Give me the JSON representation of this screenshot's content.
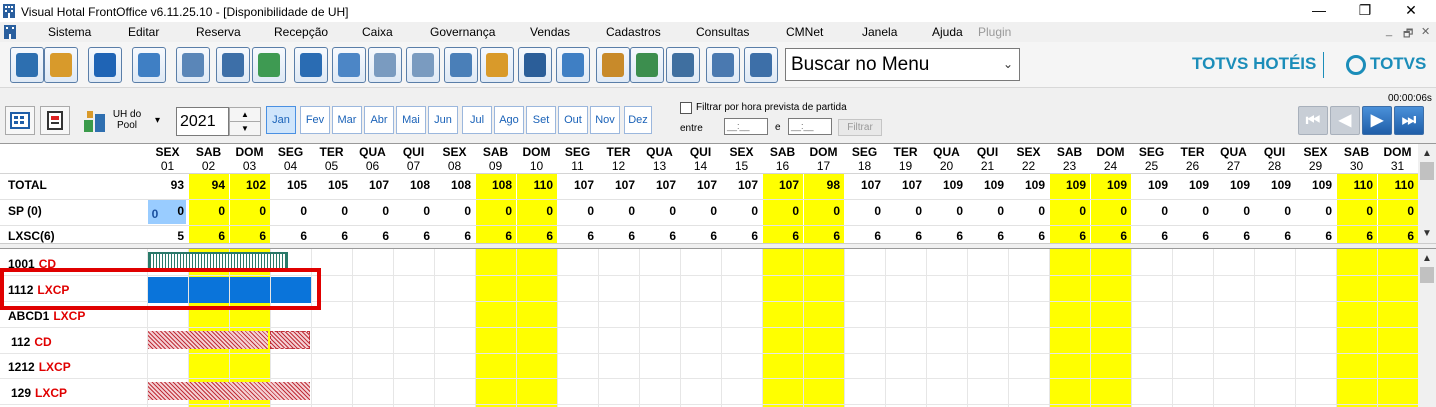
{
  "window": {
    "title": "Visual Hotal FrontOffice v6.11.25.10 - [Disponibilidade de UH]",
    "minimize": "—",
    "restore": "❐",
    "close": "✕"
  },
  "menu": {
    "items": [
      {
        "label": "Sistema"
      },
      {
        "label": "Editar"
      },
      {
        "label": "Reserva"
      },
      {
        "label": "Recepção"
      },
      {
        "label": "Caixa"
      },
      {
        "label": "Governança"
      },
      {
        "label": "Vendas"
      },
      {
        "label": "Cadastros"
      },
      {
        "label": "Consultas"
      },
      {
        "label": "CMNet"
      },
      {
        "label": "Janela"
      },
      {
        "label": "Ajuda"
      },
      {
        "label": "Plugin"
      }
    ],
    "mdi_min": "_",
    "mdi_restore": "🗗",
    "mdi_close": "✕"
  },
  "toolbar": {
    "search_value": "Buscar no Menu",
    "brand_hotels": "TOTVS HOTÉIS",
    "brand_totvs": "TOTVS",
    "buttons": [
      {
        "icon": "exit-icon",
        "color": "#2d6fb0"
      },
      {
        "icon": "user-key-icon",
        "color": "#d89a2b"
      },
      {
        "icon": "help-icon",
        "color": "#1f64b5"
      },
      {
        "icon": "org-chart-icon",
        "color": "#3f7fc4"
      },
      {
        "icon": "mail-icon",
        "color": "#5a86b8"
      },
      {
        "icon": "document-edit-icon",
        "color": "#3d6fa8"
      },
      {
        "icon": "mail-send-icon",
        "color": "#3e9a52"
      },
      {
        "icon": "search-icon",
        "color": "#2a6cb3"
      },
      {
        "icon": "calendar-icon",
        "color": "#4c86c6"
      },
      {
        "icon": "card-icon",
        "color": "#7a9bc0"
      },
      {
        "icon": "id-card-icon",
        "color": "#7a9bc0"
      },
      {
        "icon": "guest-list-icon",
        "color": "#4a7fb8"
      },
      {
        "icon": "bell-icon",
        "color": "#d99a2a"
      },
      {
        "icon": "footprints-icon",
        "color": "#2b5e99"
      },
      {
        "icon": "add-user-icon",
        "color": "#3f7fc4"
      },
      {
        "icon": "service-bell-icon",
        "color": "#c88a2a"
      },
      {
        "icon": "billing-icon",
        "color": "#3c8e4e"
      },
      {
        "icon": "cash-register-icon",
        "color": "#3f6fa0"
      },
      {
        "icon": "housekeeper-icon",
        "color": "#4a79b0"
      },
      {
        "icon": "contacts-icon",
        "color": "#3d6fa8"
      }
    ]
  },
  "controls": {
    "uh_pool_label": "UH do Pool",
    "year": "2021",
    "months": [
      "Jan",
      "Fev",
      "Mar",
      "Abr",
      "Mai",
      "Jun",
      "Jul",
      "Ago",
      "Set",
      "Out",
      "Nov",
      "Dez"
    ],
    "selected_month": "Jan",
    "filter_label": "Filtrar por hora prevista de partida",
    "entre_label": "entre",
    "e_label": "e",
    "time_from": "__:__",
    "time_to": "__:__",
    "filter_button": "Filtrar",
    "timer": "00:00:06s",
    "nav_first": "⏮",
    "nav_prev": "◀",
    "nav_next": "▶",
    "nav_last": "⏭"
  },
  "calendar": {
    "days": [
      {
        "dow": "SEX",
        "day": "01",
        "weekend": false
      },
      {
        "dow": "SAB",
        "day": "02",
        "weekend": true
      },
      {
        "dow": "DOM",
        "day": "03",
        "weekend": true
      },
      {
        "dow": "SEG",
        "day": "04",
        "weekend": false
      },
      {
        "dow": "TER",
        "day": "05",
        "weekend": false
      },
      {
        "dow": "QUA",
        "day": "06",
        "weekend": false
      },
      {
        "dow": "QUI",
        "day": "07",
        "weekend": false
      },
      {
        "dow": "SEX",
        "day": "08",
        "weekend": false
      },
      {
        "dow": "SAB",
        "day": "09",
        "weekend": true
      },
      {
        "dow": "DOM",
        "day": "10",
        "weekend": true
      },
      {
        "dow": "SEG",
        "day": "11",
        "weekend": false
      },
      {
        "dow": "TER",
        "day": "12",
        "weekend": false
      },
      {
        "dow": "QUA",
        "day": "13",
        "weekend": false
      },
      {
        "dow": "QUI",
        "day": "14",
        "weekend": false
      },
      {
        "dow": "SEX",
        "day": "15",
        "weekend": false
      },
      {
        "dow": "SAB",
        "day": "16",
        "weekend": true
      },
      {
        "dow": "DOM",
        "day": "17",
        "weekend": true
      },
      {
        "dow": "SEG",
        "day": "18",
        "weekend": false
      },
      {
        "dow": "TER",
        "day": "19",
        "weekend": false
      },
      {
        "dow": "QUA",
        "day": "20",
        "weekend": false
      },
      {
        "dow": "QUI",
        "day": "21",
        "weekend": false
      },
      {
        "dow": "SEX",
        "day": "22",
        "weekend": false
      },
      {
        "dow": "SAB",
        "day": "23",
        "weekend": true
      },
      {
        "dow": "DOM",
        "day": "24",
        "weekend": true
      },
      {
        "dow": "SEG",
        "day": "25",
        "weekend": false
      },
      {
        "dow": "TER",
        "day": "26",
        "weekend": false
      },
      {
        "dow": "QUA",
        "day": "27",
        "weekend": false
      },
      {
        "dow": "QUI",
        "day": "28",
        "weekend": false
      },
      {
        "dow": "SEX",
        "day": "29",
        "weekend": false
      },
      {
        "dow": "SAB",
        "day": "30",
        "weekend": true
      },
      {
        "dow": "DOM",
        "day": "31",
        "weekend": true
      }
    ],
    "rows": [
      {
        "label": "TOTAL",
        "values": [
          "93",
          "94",
          "102",
          "105",
          "105",
          "107",
          "108",
          "108",
          "108",
          "110",
          "107",
          "107",
          "107",
          "107",
          "107",
          "107",
          "98",
          "107",
          "107",
          "109",
          "109",
          "109",
          "109",
          "109",
          "109",
          "109",
          "109",
          "109",
          "109",
          "110",
          "110"
        ]
      },
      {
        "label": "SP  (0)",
        "first_extra": "0",
        "values": [
          "0",
          "0",
          "0",
          "0",
          "0",
          "0",
          "0",
          "0",
          "0",
          "0",
          "0",
          "0",
          "0",
          "0",
          "0",
          "0",
          "0",
          "0",
          "0",
          "0",
          "0",
          "0",
          "0",
          "0",
          "0",
          "0",
          "0",
          "0",
          "0",
          "0",
          "0"
        ]
      },
      {
        "label": "LXSC(6)",
        "values": [
          "5",
          "6",
          "6",
          "6",
          "6",
          "6",
          "6",
          "6",
          "6",
          "6",
          "6",
          "6",
          "6",
          "6",
          "6",
          "6",
          "6",
          "6",
          "6",
          "6",
          "6",
          "6",
          "6",
          "6",
          "6",
          "6",
          "6",
          "6",
          "6",
          "6",
          "6"
        ]
      }
    ],
    "highlight_color": "#ffff00",
    "selected_cell_color": "#99ccff"
  },
  "rooms": [
    {
      "number": "1001",
      "type": "CD",
      "bar": "green-hatch"
    },
    {
      "number": "1112",
      "type": "LXCP",
      "bar": "blue"
    },
    {
      "number": "ABCD1",
      "type": "LXCP",
      "bar": "none"
    },
    {
      "number": "112",
      "type": "CD",
      "bar": "red-hatch"
    },
    {
      "number": "1212",
      "type": "LXCP",
      "bar": "none"
    },
    {
      "number": "129",
      "type": "LXCP",
      "bar": "red-hatch"
    }
  ],
  "colors": {
    "accent": "#1b8db9",
    "room_type": "#e00000",
    "reservation_blue": "#0a74da",
    "selection_box": "#e00000"
  }
}
